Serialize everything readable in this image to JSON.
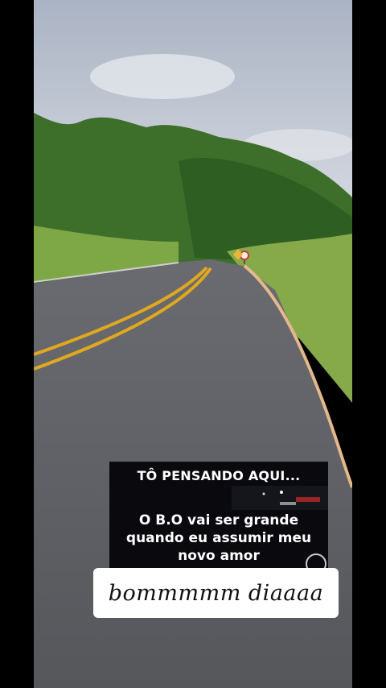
{
  "scene": {
    "description_icon": "road-photo",
    "colors": {
      "sky": "#b9c2d0",
      "foliage": "#3f7a2c",
      "asphalt": "#5d5e62",
      "centerline": "#e0a81e"
    }
  },
  "caption": {
    "title": "TÔ PENSANDO AQUI...",
    "line1": "O B.O vai ser grande",
    "line2": "quando eu assumir meu",
    "line3": "novo amor"
  },
  "sticker": {
    "text": "bommmmm diaaaa"
  }
}
